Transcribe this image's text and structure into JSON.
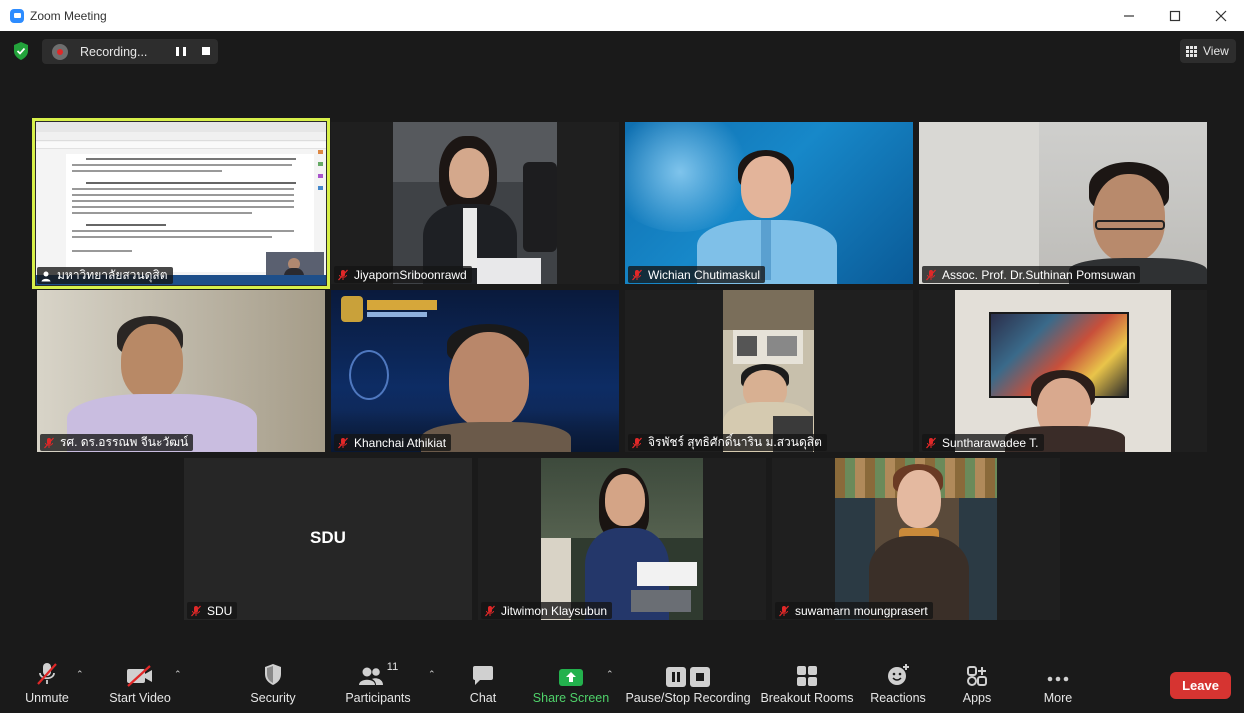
{
  "window": {
    "title": "Zoom Meeting"
  },
  "topbar": {
    "recording_label": "Recording...",
    "view_label": "View"
  },
  "participants": [
    {
      "name": "มหาวิทยาลัยสวนดุสิต",
      "active_speaker": true,
      "sharing": true
    },
    {
      "name": "JiyapornSriboonrawd",
      "muted": true
    },
    {
      "name": "Wichian Chutimaskul",
      "muted": true
    },
    {
      "name": "Assoc. Prof. Dr.Suthinan Pomsuwan",
      "muted": true
    },
    {
      "name": "รศ. ดร.อรรณพ จีนะวัฒน์",
      "muted": true
    },
    {
      "name": "Khanchai Athikiat",
      "muted": true
    },
    {
      "name": "จิรพัชร์ สุทธิศักดิ์นาริน ม.สวนดุสิต",
      "muted": true
    },
    {
      "name": "Suntharawadee T.",
      "muted": true
    },
    {
      "name": "SDU",
      "muted": true,
      "video_off_label": "SDU"
    },
    {
      "name": "Jitwimon Klaysubun",
      "muted": true
    },
    {
      "name": "suwamarn moungprasert",
      "muted": true
    }
  ],
  "toolbar": {
    "unmute": "Unmute",
    "start_video": "Start Video",
    "security": "Security",
    "participants": "Participants",
    "participants_count": "11",
    "chat": "Chat",
    "share_screen": "Share Screen",
    "pause_stop_recording": "Pause/Stop Recording",
    "breakout_rooms": "Breakout Rooms",
    "reactions": "Reactions",
    "apps": "Apps",
    "more": "More",
    "leave": "Leave"
  },
  "colors": {
    "background": "#1a1a1a",
    "active_speaker_border": "#d8f04a",
    "share_green": "#4fd16a",
    "leave_red": "#d63431",
    "muted_red": "#e02828"
  }
}
